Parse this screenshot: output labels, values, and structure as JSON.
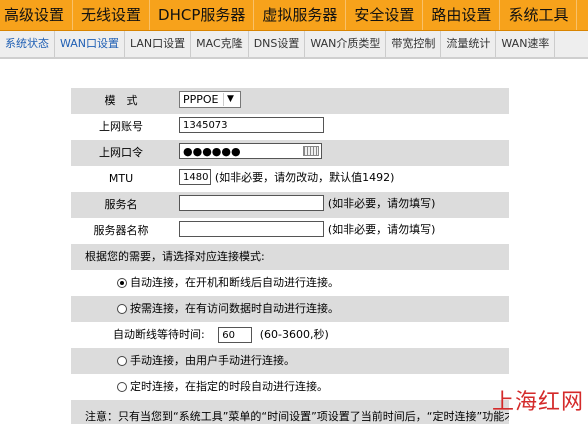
{
  "top_nav": [
    "高级设置",
    "无线设置",
    "DHCP服务器",
    "虚拟服务器",
    "安全设置",
    "路由设置",
    "系统工具"
  ],
  "sub_nav": [
    "系统状态",
    "WAN口设置",
    "LAN口设置",
    "MAC克隆",
    "DNS设置",
    "WAN介质类型",
    "带宽控制",
    "流量统计",
    "WAN速率"
  ],
  "form": {
    "mode_label": "模　式",
    "mode_value": "PPPOE",
    "account_label": "上网账号",
    "account_value": "1345073",
    "password_label": "上网口令",
    "password_value": "●●●●●●",
    "mtu_label": "MTU",
    "mtu_value": "1480",
    "mtu_note": "(如非必要，请勿改动，默认值1492)",
    "service_label": "服务名",
    "service_value": "",
    "service_note": "(如非必要，请勿填写)",
    "server_label": "服务器名称",
    "server_value": "",
    "server_note": "(如非必要，请勿填写)",
    "mode_select_prompt": "根据您的需要，请选择对应连接模式:",
    "opt_auto": "自动连接，在开机和断线后自动进行连接。",
    "opt_on_demand": "按需连接，在有访问数据时自动进行连接。",
    "idle_label": "自动断线等待时间:",
    "idle_value": "60",
    "idle_note": "(60-3600,秒)",
    "opt_manual": "手动连接，由用户手动进行连接。",
    "opt_scheduled": "定时连接，在指定的时段自动进行连接。",
    "footer_note": "注意：只有当您到“系统工具”菜单的“时间设置”项设置了当前时间后，“定时连接”功能才能生效。"
  },
  "watermark": "上海红网"
}
